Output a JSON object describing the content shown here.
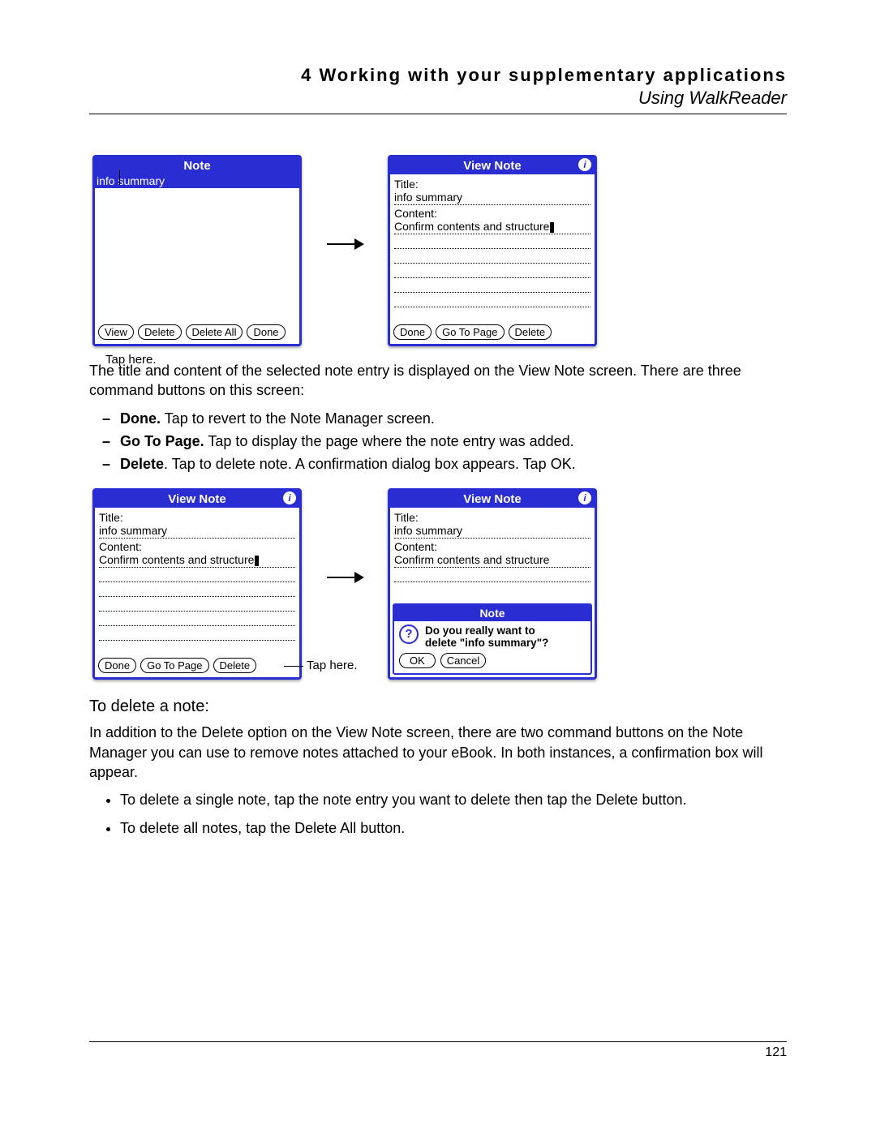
{
  "header": {
    "chapter_num": "4",
    "chapter_title": "Working with your supplementary applications",
    "section": "Using WalkReader"
  },
  "footer": {
    "page": "121"
  },
  "callouts": {
    "tap_here": "Tap here."
  },
  "screens": {
    "note_manager": {
      "title": "Note",
      "selected_entry": "info summary",
      "buttons": {
        "view": "View",
        "delete": "Delete",
        "delete_all": "Delete All",
        "done": "Done"
      }
    },
    "view_note": {
      "title": "View Note",
      "title_label": "Title:",
      "title_value": "info summary",
      "content_label": "Content:",
      "content_value": "Confirm contents and structure",
      "buttons": {
        "done": "Done",
        "go_to_page": "Go To Page",
        "delete": "Delete"
      }
    },
    "confirm_delete": {
      "title": "Note",
      "message_l1": "Do you really want to",
      "message_l2": "delete \"info summary\"?",
      "ok": "OK",
      "cancel": "Cancel"
    }
  },
  "body": {
    "intro_p1": "The title and content of the selected note entry is displayed on the View Note screen. There are three command buttons on this screen:",
    "cmds": {
      "done_b": "Done.",
      "done_t": " Tap to revert to the Note Manager screen.",
      "gtp_b": "Go To Page.",
      "gtp_t": " Tap to display the page where the note entry was added.",
      "del_b": "Delete",
      "del_t": ". Tap to delete note. A confirmation dialog box appears. Tap OK."
    },
    "subhead": "To delete a note:",
    "p2": "In addition to the Delete option on the View Note screen, there are two command buttons on the Note Manager you can use to remove notes attached to your eBook. In both instances, a confirmation box will appear.",
    "b1": "To delete a single note, tap the note entry you want to delete then tap the Delete button.",
    "b2": "To delete all notes, tap the Delete All button."
  }
}
